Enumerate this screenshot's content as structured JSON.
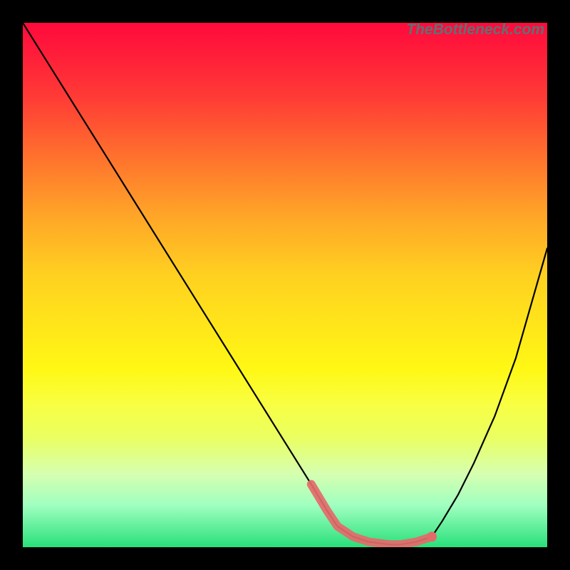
{
  "attribution": "TheBottleneck.com",
  "chart_data": {
    "type": "line",
    "title": "",
    "xlabel": "",
    "ylabel": "",
    "xlim": [
      0,
      100
    ],
    "ylim": [
      0,
      100
    ],
    "series": [
      {
        "name": "curve",
        "x": [
          0,
          5,
          10,
          15,
          20,
          25,
          30,
          35,
          40,
          45,
          50,
          55,
          58,
          60,
          63,
          66,
          70,
          72,
          75,
          78,
          80,
          83,
          86,
          90,
          94,
          100
        ],
        "y": [
          100,
          92,
          84,
          76,
          68,
          60,
          52,
          44,
          36,
          28,
          20,
          12,
          7,
          4,
          2,
          1,
          0.5,
          0.5,
          1,
          2,
          5,
          10,
          16,
          25,
          36,
          57
        ]
      },
      {
        "name": "highlight-band",
        "x": [
          55,
          58,
          60,
          63,
          66,
          70,
          72,
          75,
          78
        ],
        "y": [
          12,
          7,
          4,
          2,
          1,
          0.5,
          0.5,
          1,
          2
        ]
      }
    ],
    "highlight_marker": {
      "x": 78,
      "y": 2
    },
    "background_gradient": [
      "#ff0a3c",
      "#ffe61a",
      "#28e07a"
    ]
  }
}
